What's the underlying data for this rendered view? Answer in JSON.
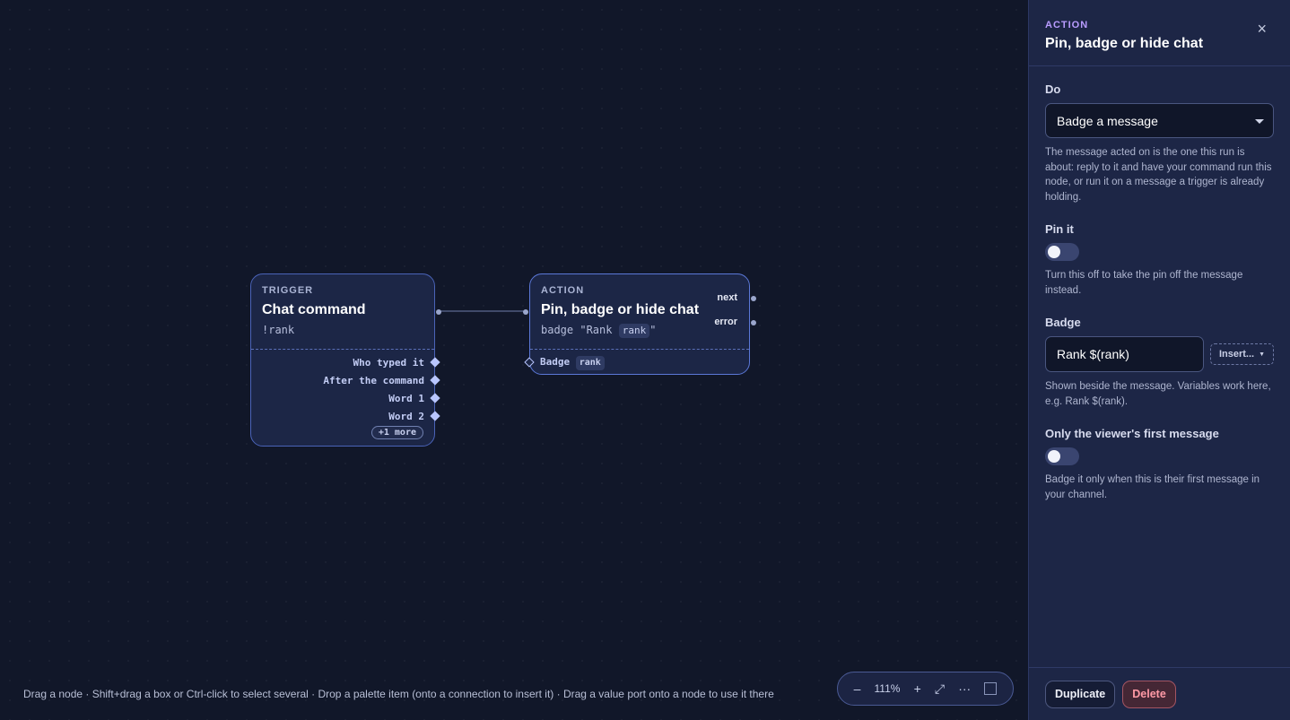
{
  "canvas": {
    "hint": "Drag a node · Shift+drag a box or Ctrl-click to select several · Drop a palette item (onto a connection to insert it) · Drag a value port onto a node to use it there",
    "zoom": {
      "minus": "–",
      "level": "111%",
      "plus": "+",
      "fit": "⤢",
      "more": "···"
    }
  },
  "trigger_node": {
    "kind": "TRIGGER",
    "title": "Chat command",
    "subtitle": "!rank",
    "ports": [
      "Who typed it",
      "After the command",
      "Word 1",
      "Word 2"
    ],
    "more": "+1 more"
  },
  "action_node": {
    "kind": "ACTION",
    "title": "Pin, badge or hide chat",
    "subtitle_prefix": "badge \"Rank ",
    "subtitle_chip": "rank",
    "subtitle_suffix": "\"",
    "outputs": {
      "next": "next",
      "error": "error"
    },
    "input_label": "Badge",
    "input_chip": "rank"
  },
  "panel": {
    "kind": "ACTION",
    "title": "Pin, badge or hide chat",
    "close_icon": "×",
    "do": {
      "label": "Do",
      "value": "Badge a message",
      "help": "The message acted on is the one this run is about: reply to it and have your command run this node, or run it on a message a trigger is already holding."
    },
    "pin": {
      "label": "Pin it",
      "on": false,
      "help": "Turn this off to take the pin off the message instead."
    },
    "badge": {
      "label": "Badge",
      "value": "Rank $(rank)",
      "insert": "Insert...",
      "help": "Shown beside the message. Variables work here, e.g. Rank $(rank)."
    },
    "first_message": {
      "label": "Only the viewer's first message",
      "on": false,
      "help": "Badge it only when this is their first message in your channel."
    },
    "footer": {
      "duplicate": "Duplicate",
      "delete": "Delete"
    }
  }
}
